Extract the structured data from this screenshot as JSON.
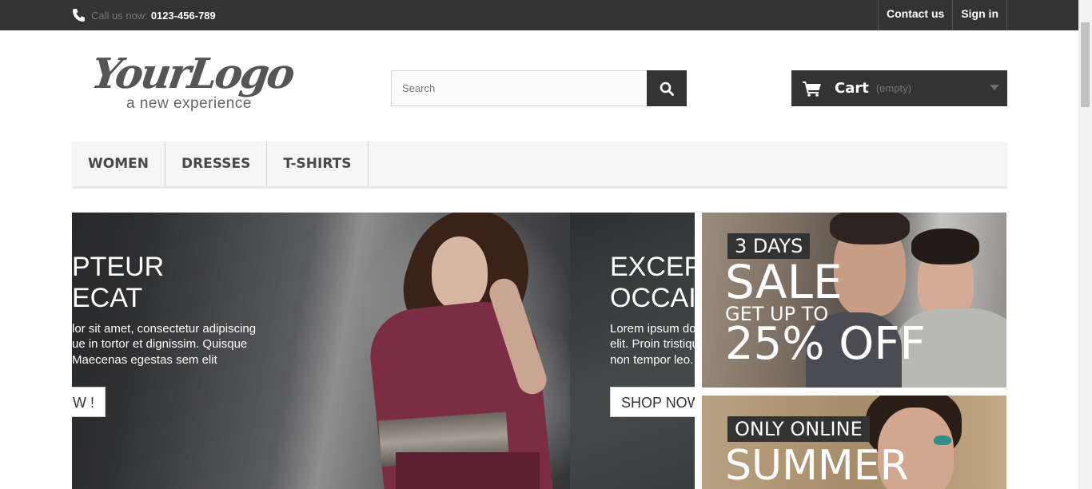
{
  "topbar": {
    "call_label": "Call us now:",
    "phone": "0123-456-789",
    "contact_link": "Contact us",
    "signin_link": "Sign in"
  },
  "logo": {
    "script_text": "YourLogo",
    "tagline": "a new experience"
  },
  "search": {
    "placeholder": "Search",
    "value": ""
  },
  "cart": {
    "label": "Cart",
    "status": "(empty)"
  },
  "menu": {
    "items": [
      {
        "label": "Women"
      },
      {
        "label": "Dresses"
      },
      {
        "label": "T-shirts"
      }
    ]
  },
  "slider": {
    "slides": [
      {
        "title_line1": "PTEUR",
        "title_line2": "ECAT",
        "text_line1": "lor sit amet, consectetur adipiscing",
        "text_line2": "ue in tortor et dignissim. Quisque",
        "text_line3": " Maecenas egestas sem elit",
        "button": "W !"
      },
      {
        "title_line1": "EXCEP",
        "title_line2": "OCCAI",
        "text_line1": "Lorem ipsum do",
        "text_line2": "elit. Proin tristiqu",
        "text_line3": "non tempor leo.",
        "button": "SHOP NOW"
      }
    ]
  },
  "banners": [
    {
      "tag": "3 DAYS",
      "line1": "SALE",
      "line2": "GET UP TO",
      "line3": "25% OFF"
    },
    {
      "tag": "ONLY ONLINE",
      "line1": "SUMMER"
    }
  ],
  "colors": {
    "dark": "#333333",
    "menu_bg": "#f6f6f6",
    "border": "#d6d4d4"
  }
}
